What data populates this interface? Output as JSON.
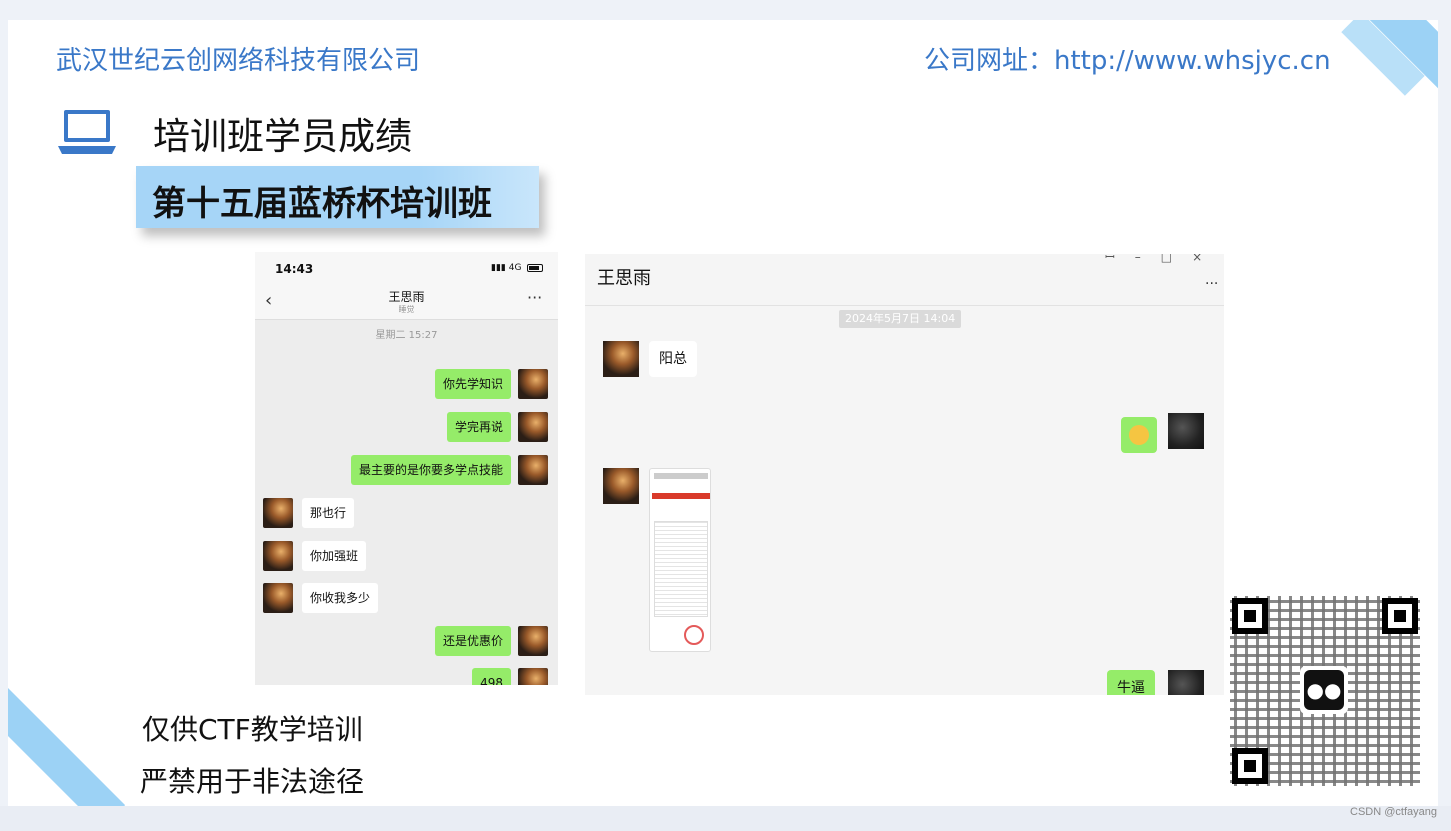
{
  "header": {
    "company": "武汉世纪云创网络科技有限公司",
    "website": "公司网址：http://www.whsjyc.cn"
  },
  "section": {
    "title": "培训班学员成绩",
    "banner": "第十五届蓝桥杯培训班"
  },
  "phone_chat": {
    "time": "14:43",
    "signal": "4G",
    "contact": "王思雨",
    "contact_sub": "睡觉",
    "date": "星期二 15:27",
    "messages": [
      {
        "side": "right",
        "text": "你先学知识"
      },
      {
        "side": "right",
        "text": "学完再说"
      },
      {
        "side": "right",
        "text": "最主要的是你要多学点技能"
      },
      {
        "side": "left",
        "text": "那也行"
      },
      {
        "side": "left",
        "text": "你加强班"
      },
      {
        "side": "left",
        "text": "你收我多少"
      },
      {
        "side": "right",
        "text": "还是优惠价"
      },
      {
        "side": "right",
        "text": "498"
      }
    ]
  },
  "desktop_chat": {
    "contact": "王思雨",
    "timestamp": "2024年5月7日 14:04",
    "msg_left_1": "阳总",
    "msg_right_last": "牛逼"
  },
  "notes": {
    "line1": "仅供CTF教学培训",
    "line2": "严禁用于非法途径"
  },
  "watermark": "CSDN @ctfayang",
  "colors": {
    "accent": "#3a78c8",
    "banner": "#a6d5f7",
    "bubble_green": "#95ec69"
  }
}
